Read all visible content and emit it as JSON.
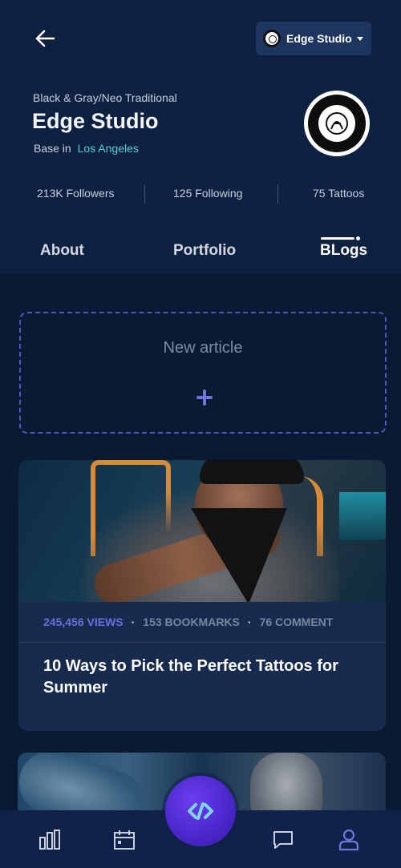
{
  "header": {
    "selected_studio": "Edge Studio",
    "style": "Black & Gray/Neo Traditional",
    "name": "Edge Studio",
    "location_prefix": "Base in",
    "location_city": "Los Angeles"
  },
  "stats": {
    "followers": "213K Followers",
    "following": "125 Following",
    "tattoos": "75 Tattoos"
  },
  "tabs": {
    "about": "About",
    "portfolio": "Portfolio",
    "blogs": "BLogs"
  },
  "new_article": {
    "label": "New article"
  },
  "articles": [
    {
      "views": "245,456 VIEWS",
      "bookmarks": "153 BOOKMARKS",
      "comments": "76 COMMENT",
      "title": "10 Ways to Pick the Perfect Tattoos for Summer"
    }
  ],
  "icons": {
    "back": "arrow-left",
    "nav_stats": "bar-chart",
    "nav_calendar": "calendar",
    "nav_center": "link-code",
    "nav_messages": "chat-bubble",
    "nav_profile": "user"
  },
  "colors": {
    "background": "#0b1a33",
    "accent": "#6870e0",
    "location": "#4fd0d5",
    "fab": "#4a26c9"
  }
}
